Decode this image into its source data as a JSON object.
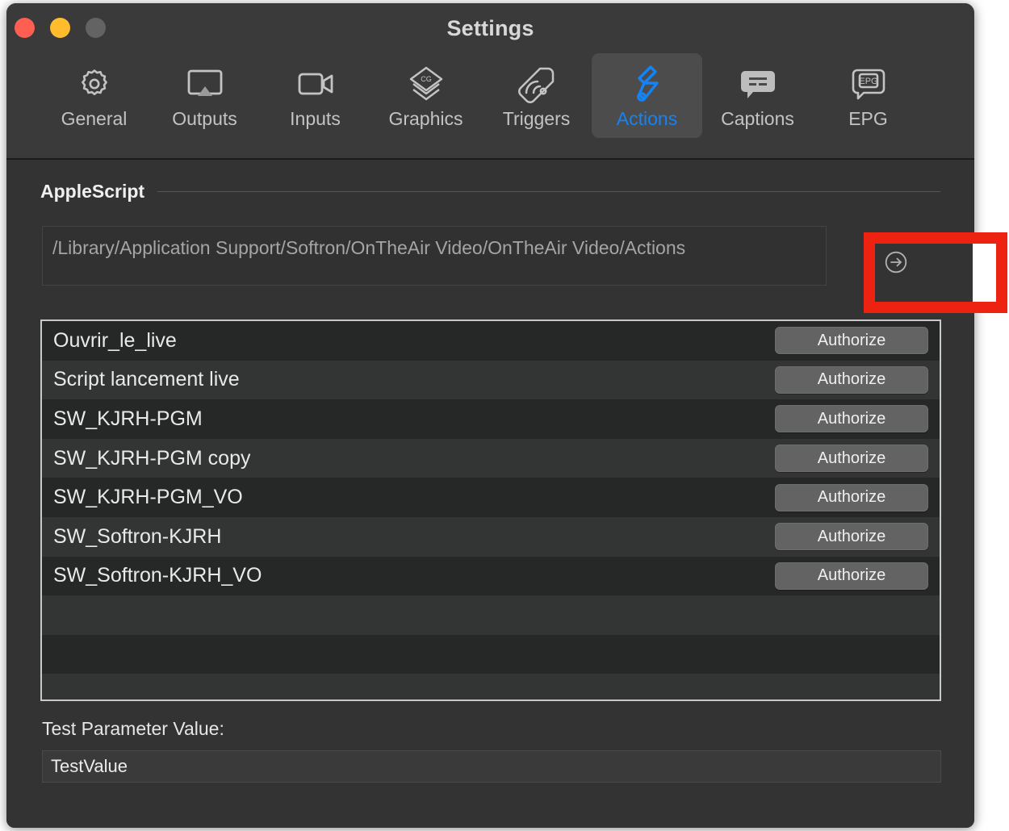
{
  "window": {
    "title": "Settings",
    "traffic_lights": [
      "close-red",
      "minimize-yellow",
      "zoom-grey"
    ]
  },
  "toolbar": {
    "tabs": [
      {
        "label": "General",
        "icon": "gear-icon",
        "active": false
      },
      {
        "label": "Outputs",
        "icon": "display-icon",
        "active": false
      },
      {
        "label": "Inputs",
        "icon": "video-camera-icon",
        "active": false
      },
      {
        "label": "Graphics",
        "icon": "cg-layers-icon",
        "active": false
      },
      {
        "label": "Triggers",
        "icon": "wireless-tag-icon",
        "active": false
      },
      {
        "label": "Actions",
        "icon": "action-bolt-icon",
        "active": true
      },
      {
        "label": "Captions",
        "icon": "caption-bubble-icon",
        "active": false
      },
      {
        "label": "EPG",
        "icon": "epg-bubble-icon",
        "active": false
      }
    ],
    "active_color": "#1383f5"
  },
  "section": {
    "title": "AppleScript",
    "path_value": "/Library/Application Support/Softron/OnTheAir Video/OnTheAir Video/Actions",
    "go_button_icon": "arrow-right-circle-icon"
  },
  "list": {
    "rows": [
      {
        "name": "Ouvrir_le_live",
        "button": "Authorize"
      },
      {
        "name": "Script lancement live",
        "button": "Authorize"
      },
      {
        "name": "SW_KJRH-PGM",
        "button": "Authorize"
      },
      {
        "name": "SW_KJRH-PGM copy",
        "button": "Authorize"
      },
      {
        "name": "SW_KJRH-PGM_VO",
        "button": "Authorize"
      },
      {
        "name": "SW_Softron-KJRH",
        "button": "Authorize"
      },
      {
        "name": "SW_Softron-KJRH_VO",
        "button": "Authorize"
      }
    ],
    "empty_row_count": 3
  },
  "footer": {
    "param_label": "Test Parameter Value:",
    "param_value": "TestValue"
  },
  "annotation": {
    "type": "highlight-rectangle",
    "color": "#ee2211",
    "target": "go-button"
  }
}
